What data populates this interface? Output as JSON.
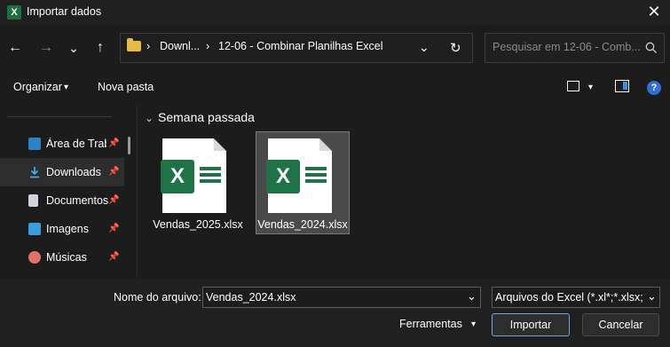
{
  "window": {
    "title": "Importar dados",
    "app_icon": "excel-icon",
    "close": "✕"
  },
  "nav": {
    "back": "←",
    "forward": "→",
    "recent": "⌄",
    "up": "↑",
    "breadcrumbs": [
      "Downl...",
      "12-06 - Combinar Planilhas Excel"
    ],
    "separator": "›",
    "refresh": "↻",
    "dropdown": "⌄"
  },
  "search": {
    "placeholder": "Pesquisar em 12-06 - Comb...",
    "icon": "search-icon"
  },
  "toolbar": {
    "organize": "Organizar",
    "new_folder": "Nova pasta",
    "caret": "▾",
    "help": "?"
  },
  "sidebar": {
    "items": [
      {
        "label": "Área de Trabalho",
        "icon": "desktop-icon"
      },
      {
        "label": "Downloads",
        "icon": "download-icon"
      },
      {
        "label": "Documentos",
        "icon": "document-icon"
      },
      {
        "label": "Imagens",
        "icon": "pictures-icon"
      },
      {
        "label": "Músicas",
        "icon": "music-icon"
      }
    ]
  },
  "main": {
    "group_title": "Semana passada",
    "files": [
      {
        "name": "Vendas_2025.xlsx",
        "selected": false
      },
      {
        "name": "Vendas_2024.xlsx",
        "selected": true
      }
    ]
  },
  "footer": {
    "filename_label": "Nome do arquivo:",
    "filename_value": "Vendas_2024.xlsx",
    "filetype_value": "Arquivos do Excel (*.xl*;*.xlsx;*.",
    "tools_label": "Ferramentas",
    "import_button": "Importar",
    "cancel_button": "Cancelar"
  },
  "colors": {
    "background": "#1c1c1c",
    "excel_green": "#1f7246",
    "accent": "#2f6fd4"
  }
}
